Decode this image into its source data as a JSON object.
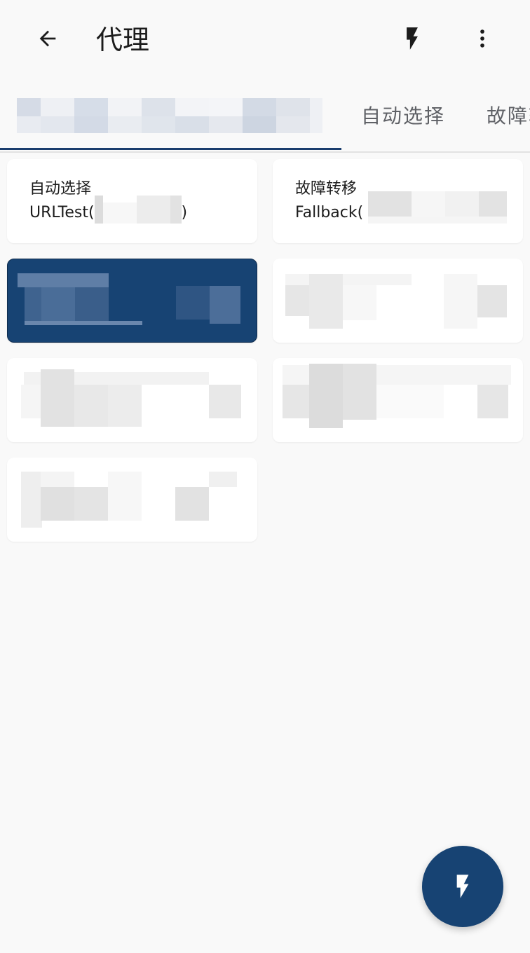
{
  "appbar": {
    "title": "代理",
    "back_icon": "arrow-back-icon",
    "action_icon": "flash-icon",
    "more_icon": "more-vert-icon"
  },
  "tabs": [
    {
      "label": "",
      "selected": true
    },
    {
      "label": "自动选择",
      "selected": false
    },
    {
      "label": "故障转移",
      "selected": false
    }
  ],
  "groups": [
    {
      "title": "自动选择",
      "subtitle": "URLTest(",
      "subtitle_end": ")",
      "selected": false
    },
    {
      "title": "故障转移",
      "subtitle": "Fallback(",
      "subtitle_end": "",
      "selected": false
    },
    {
      "title": "",
      "subtitle": "",
      "subtitle_end": "",
      "selected": true
    },
    {
      "title": "",
      "subtitle": "",
      "subtitle_end": "",
      "selected": false
    },
    {
      "title": "",
      "subtitle": "",
      "subtitle_end": "",
      "selected": false
    },
    {
      "title": "",
      "subtitle": "",
      "subtitle_end": "",
      "selected": false
    },
    {
      "title": "",
      "subtitle": "",
      "subtitle_end": "",
      "selected": false
    }
  ],
  "fab": {
    "icon": "flash-icon"
  },
  "colors": {
    "primary": "#174373",
    "background": "#f9f9f9",
    "card": "#ffffff",
    "tab_inactive": "#5f6166"
  }
}
